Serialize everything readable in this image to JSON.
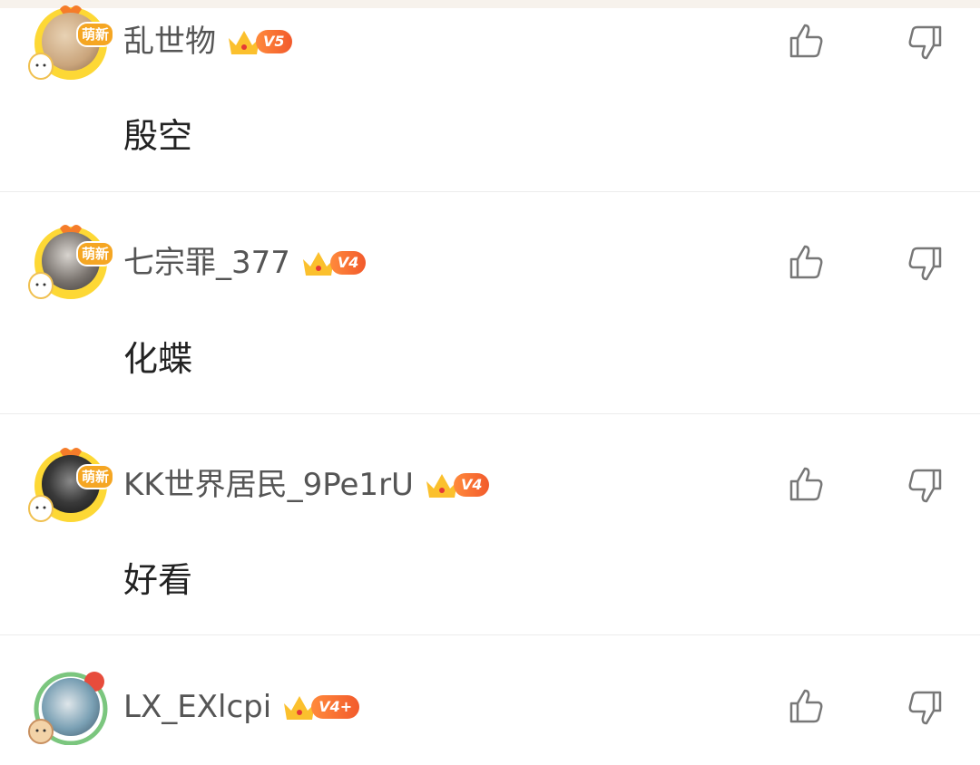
{
  "comments": [
    {
      "username": "乱世物",
      "level": "V5",
      "avatar_badge": "萌新",
      "text": "殷空",
      "avatar_color": "#caa57c"
    },
    {
      "username": "七宗罪_377",
      "level": "V4",
      "avatar_badge": "萌新",
      "text": "化蝶",
      "avatar_color": "#6e6a68"
    },
    {
      "username": "KK世界居民_9Pe1rU",
      "level": "V4",
      "avatar_badge": "萌新",
      "text": "好看",
      "avatar_color": "#2c2c2c"
    },
    {
      "username": "LX_EXlcpi",
      "level": "V4+",
      "avatar_badge": "",
      "text": "",
      "avatar_color": "#7aa0b4"
    }
  ],
  "icons": {
    "like": "thumbs-up-icon",
    "dislike": "thumbs-down-icon",
    "crown": "crown-icon"
  },
  "colors": {
    "accent_orange": "#f25a2c",
    "badge_yellow": "#f5a623",
    "frame_yellow": "#fdd835"
  }
}
